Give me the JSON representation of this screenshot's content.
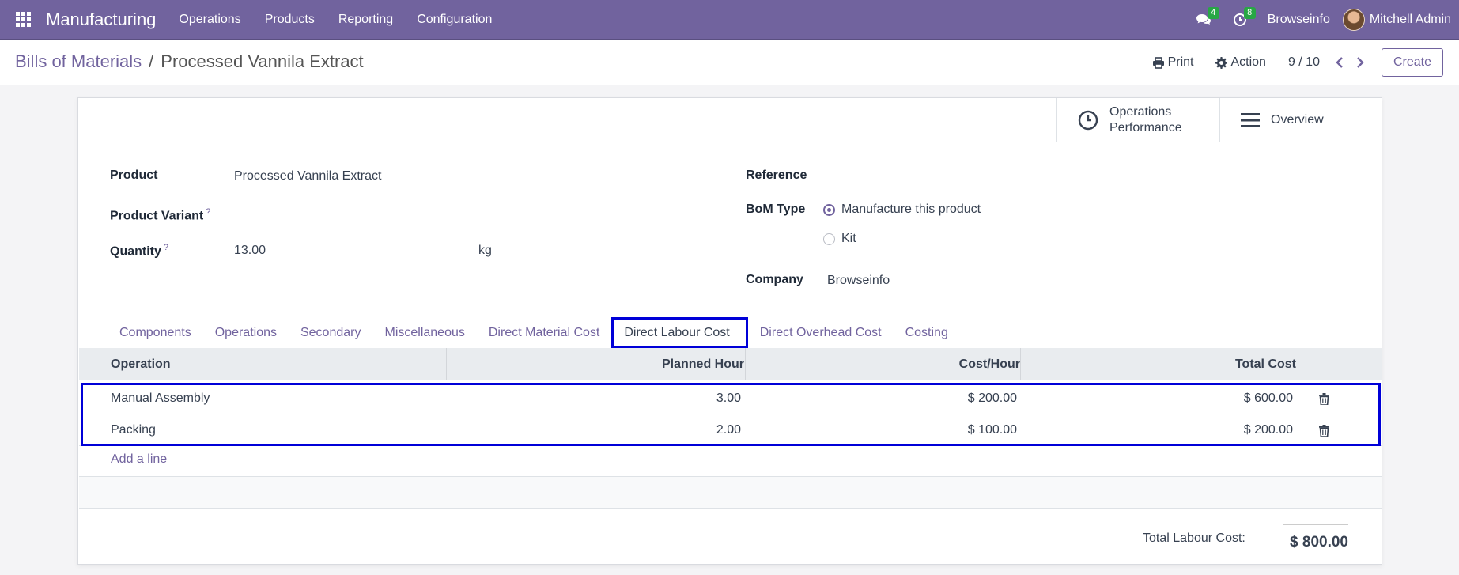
{
  "navbar": {
    "app_name": "Manufacturing",
    "menu": [
      "Operations",
      "Products",
      "Reporting",
      "Configuration"
    ],
    "messages_count": "4",
    "activities_count": "8",
    "company": "Browseinfo",
    "user": "Mitchell Admin",
    "accent": "#71639e"
  },
  "breadcrumb": {
    "parent": "Bills of Materials",
    "separator": "/",
    "current": "Processed Vannila Extract"
  },
  "toolbar": {
    "print": "Print",
    "action": "Action",
    "pager": "9 / 10",
    "create": "Create"
  },
  "smart_buttons": {
    "perf_line1": "Operations",
    "perf_line2": "Performance",
    "overview": "Overview"
  },
  "form": {
    "product_label": "Product",
    "product_value": "Processed Vannila Extract",
    "variant_label": "Product Variant",
    "variant_help": "?",
    "quantity_label": "Quantity",
    "quantity_help": "?",
    "quantity_value": "13.00",
    "uom": "kg",
    "reference_label": "Reference",
    "bom_type_label": "BoM Type",
    "bom_type_options": [
      "Manufacture this product",
      "Kit"
    ],
    "bom_type_selected": "Manufacture this product",
    "company_label": "Company",
    "company_value": "Browseinfo"
  },
  "tabs": [
    "Components",
    "Operations",
    "Secondary",
    "Miscellaneous",
    "Direct Material Cost",
    "Direct Labour Cost",
    "Direct Overhead Cost",
    "Costing"
  ],
  "active_tab": "Direct Labour Cost",
  "table": {
    "headers": [
      "Operation",
      "Planned Hour",
      "Cost/Hour",
      "Total Cost"
    ],
    "rows": [
      {
        "operation": "Manual Assembly",
        "planned_hour": "3.00",
        "cost_hour": "$ 200.00",
        "total_cost": "$ 600.00"
      },
      {
        "operation": "Packing",
        "planned_hour": "2.00",
        "cost_hour": "$ 100.00",
        "total_cost": "$ 200.00"
      }
    ],
    "add_line": "Add a line"
  },
  "totals": {
    "label": "Total Labour Cost:",
    "value": "$ 800.00"
  }
}
